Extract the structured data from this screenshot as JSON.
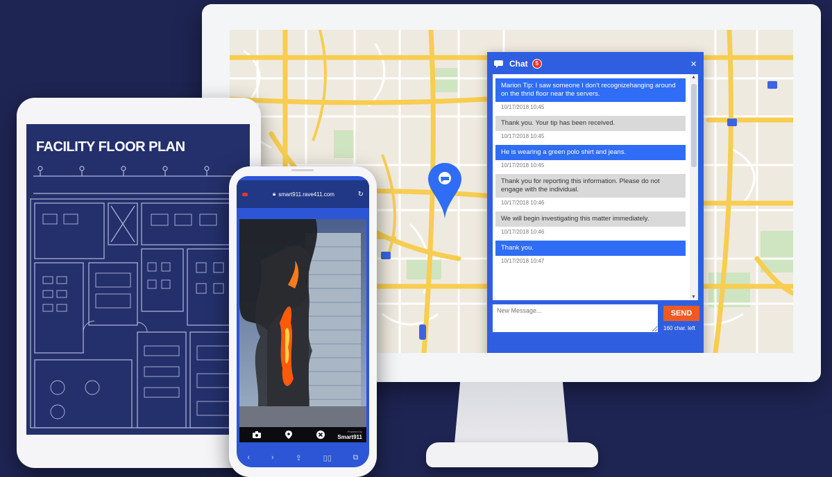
{
  "chat": {
    "title": "Chat",
    "badge": "5",
    "close": "×",
    "messages": [
      {
        "sender": "user",
        "text": "Marion Tip: I saw someone I don't recognizehanging around on the thrid floor near the servers.",
        "time": "10/17/2018 10:45"
      },
      {
        "sender": "agent",
        "text": "Thank you. Your tip has been received.",
        "time": "10/17/2018 10:45"
      },
      {
        "sender": "user",
        "text": "He is wearing a green polo shirt and jeans.",
        "time": "10/17/2018 10:45"
      },
      {
        "sender": "agent",
        "text": "Thank you for reporting this information. Please do not engage with the individual.",
        "time": "10/17/2018 10:46"
      },
      {
        "sender": "agent",
        "text": "We will begin investigating this matter immediately.",
        "time": "10/17/2018 10:46"
      },
      {
        "sender": "user",
        "text": "Thank you.",
        "time": "10/17/2018 10:47"
      }
    ],
    "input_placeholder": "New Message...",
    "send_label": "SEND",
    "char_left": "160 char. left"
  },
  "tablet": {
    "title": "FACILITY FLOOR PLAN"
  },
  "phone": {
    "url": "smart911.rave411.com",
    "powered_by": "Powered by",
    "brand": "Smart911"
  },
  "colors": {
    "background": "#1e2553",
    "chat_blue": "#2f5fe0",
    "user_bubble": "#2f6df6",
    "agent_bubble": "#d9d9d9",
    "send_orange": "#f05a22",
    "blueprint": "#24306b",
    "map_road": "#f7cd52"
  },
  "icons": [
    "chat-bubble-icon",
    "close-icon",
    "map-pin-icon",
    "lock-icon",
    "reload-icon",
    "camera-icon",
    "location-pin-icon",
    "cancel-icon",
    "share-icon",
    "book-icon",
    "tabs-icon"
  ]
}
